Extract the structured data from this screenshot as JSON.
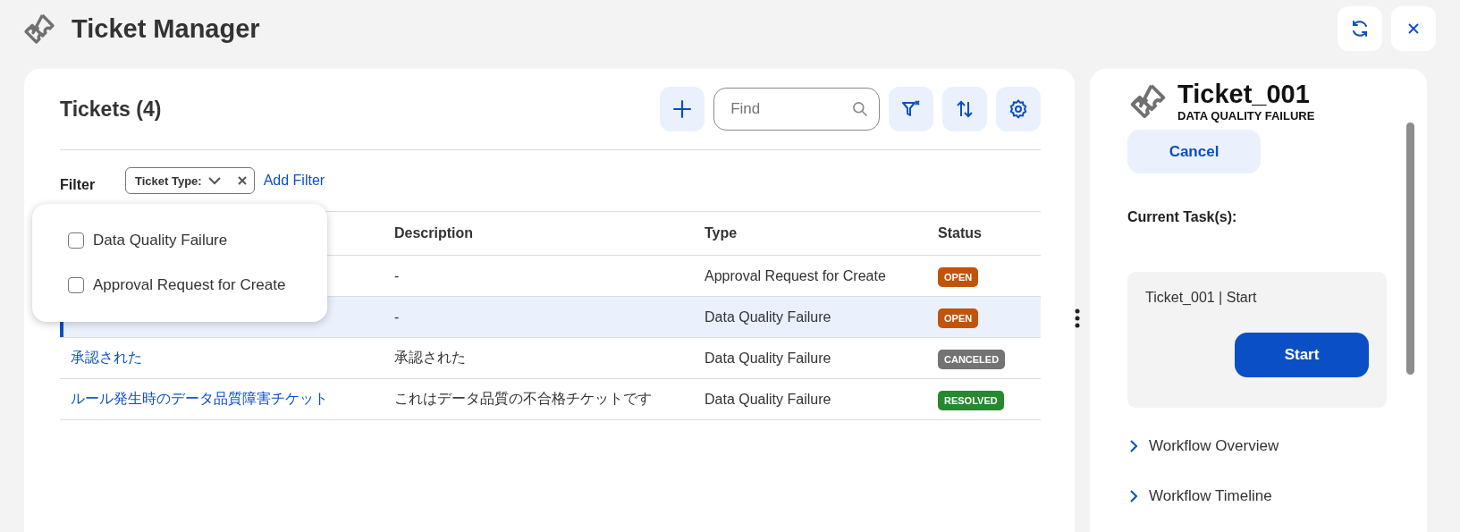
{
  "app": {
    "title": "Ticket Manager"
  },
  "tickets": {
    "title": "Tickets (4)",
    "search": {
      "placeholder": "Find"
    },
    "filter": {
      "label": "Filter",
      "chip": "Ticket Type:",
      "add_link": "Add Filter",
      "options": [
        {
          "label": "Data Quality Failure",
          "checked": false
        },
        {
          "label": "Approval Request for Create",
          "checked": false
        }
      ]
    },
    "columns": [
      "Description",
      "Type",
      "Status"
    ],
    "rows": [
      {
        "description": "-",
        "type": "Approval Request for Create",
        "status": {
          "label": "OPEN",
          "color": "#c25409"
        },
        "selected": false
      },
      {
        "description": "-",
        "type": "Data Quality Failure",
        "status": {
          "label": "OPEN",
          "color": "#c25409"
        },
        "selected": true
      },
      {
        "name": "承認された",
        "description": "承認された",
        "type": "Data Quality Failure",
        "status": {
          "label": "CANCELED",
          "color": "#737373"
        },
        "selected": false
      },
      {
        "name": "ルール発生時のデータ品質障害チケット",
        "description": "これはデータ品質の不合格チケットです",
        "type": "Data Quality Failure",
        "status": {
          "label": "RESOLVED",
          "color": "#27892f"
        },
        "selected": false
      }
    ]
  },
  "detail": {
    "title": "Ticket_001",
    "subtitle": "DATA QUALITY FAILURE",
    "cancel_button": "Cancel",
    "tasks_label": "Current Task(s):",
    "task": {
      "text": "Ticket_001 | Start",
      "button": "Start"
    },
    "sections": [
      {
        "label": "Workflow Overview",
        "expanded": false
      },
      {
        "label": "Workflow Timeline",
        "expanded": false
      }
    ]
  }
}
